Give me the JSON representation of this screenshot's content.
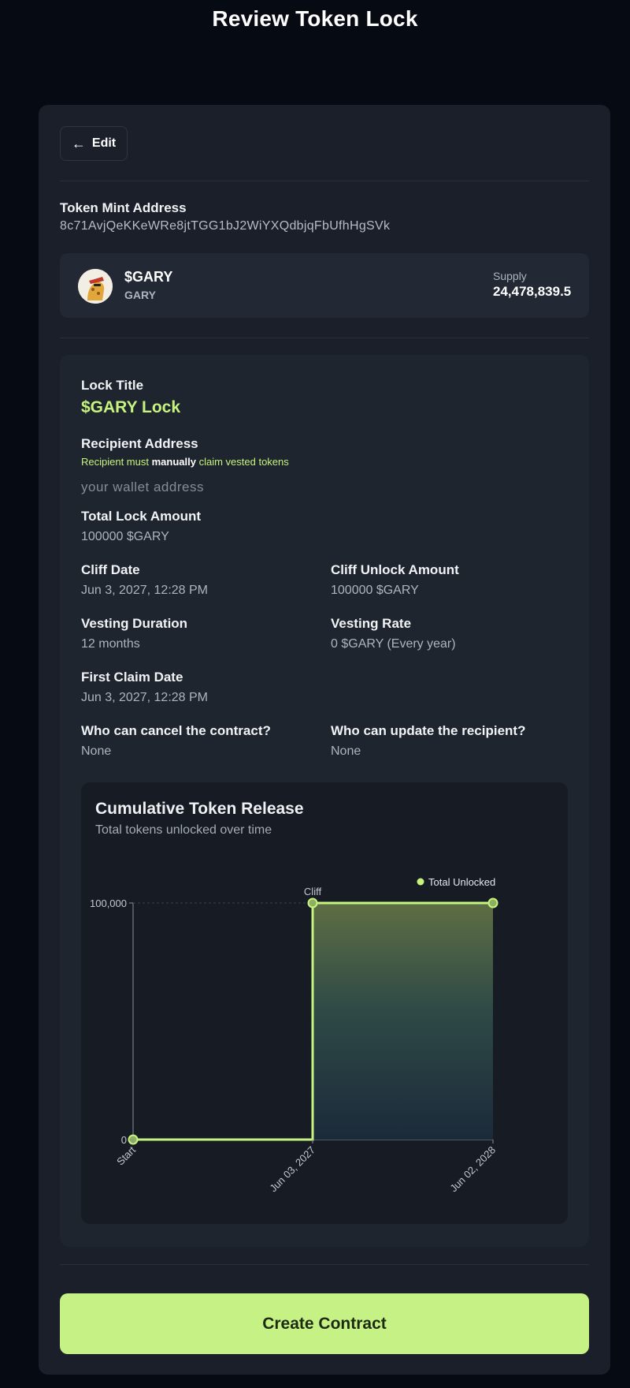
{
  "header": {
    "title": "Review Token Lock"
  },
  "edit": {
    "label": "Edit"
  },
  "mint": {
    "label": "Token Mint Address",
    "value": "8c71AvjQeKKeWRe8jtTGG1bJ2WiYXQdbjqFbUfhHgSVk"
  },
  "token": {
    "symbol": "$GARY",
    "name": "GARY",
    "supply_label": "Supply",
    "supply_value": "24,478,839.5"
  },
  "details": {
    "lock_title_label": "Lock Title",
    "lock_title_value": "$GARY Lock",
    "recipient_label": "Recipient Address",
    "recipient_note_pre": "Recipient must",
    "recipient_note_bold": "manually",
    "recipient_note_post": "claim vested tokens",
    "recipient_placeholder": "your wallet address",
    "total_lock_label": "Total Lock Amount",
    "total_lock_value": "100000 $GARY",
    "cliff_date_label": "Cliff Date",
    "cliff_date_value": "Jun 3, 2027, 12:28 PM",
    "cliff_unlock_label": "Cliff Unlock Amount",
    "cliff_unlock_value": "100000 $GARY",
    "vesting_duration_label": "Vesting Duration",
    "vesting_duration_value": "12 months",
    "vesting_rate_label": "Vesting Rate",
    "vesting_rate_value": "0 $GARY (Every year)",
    "first_claim_label": "First Claim Date",
    "first_claim_value": "Jun 3, 2027, 12:28 PM",
    "cancel_label": "Who can cancel the contract?",
    "cancel_value": "None",
    "update_label": "Who can update the recipient?",
    "update_value": "None"
  },
  "chart": {
    "title": "Cumulative Token Release",
    "subtitle": "Total tokens unlocked over time",
    "accent": "#c6f47f"
  },
  "chart_data": {
    "type": "area",
    "title": "Cumulative Token Release",
    "subtitle": "Total tokens unlocked over time",
    "x": [
      "Start",
      "Jun 03, 2027",
      "Jun 03, 2027",
      "Jun 02, 2028"
    ],
    "series": [
      {
        "name": "Total Unlocked",
        "values": [
          0,
          0,
          100000,
          100000
        ]
      }
    ],
    "x_tick_labels": [
      "Start",
      "Jun 03, 2027",
      "Jun 02, 2028"
    ],
    "y_tick_labels": [
      "0",
      "100,000"
    ],
    "ylim": [
      0,
      100000
    ],
    "annotations": [
      "Cliff"
    ],
    "legend": "top-right",
    "grid": false
  },
  "create": {
    "label": "Create Contract"
  }
}
